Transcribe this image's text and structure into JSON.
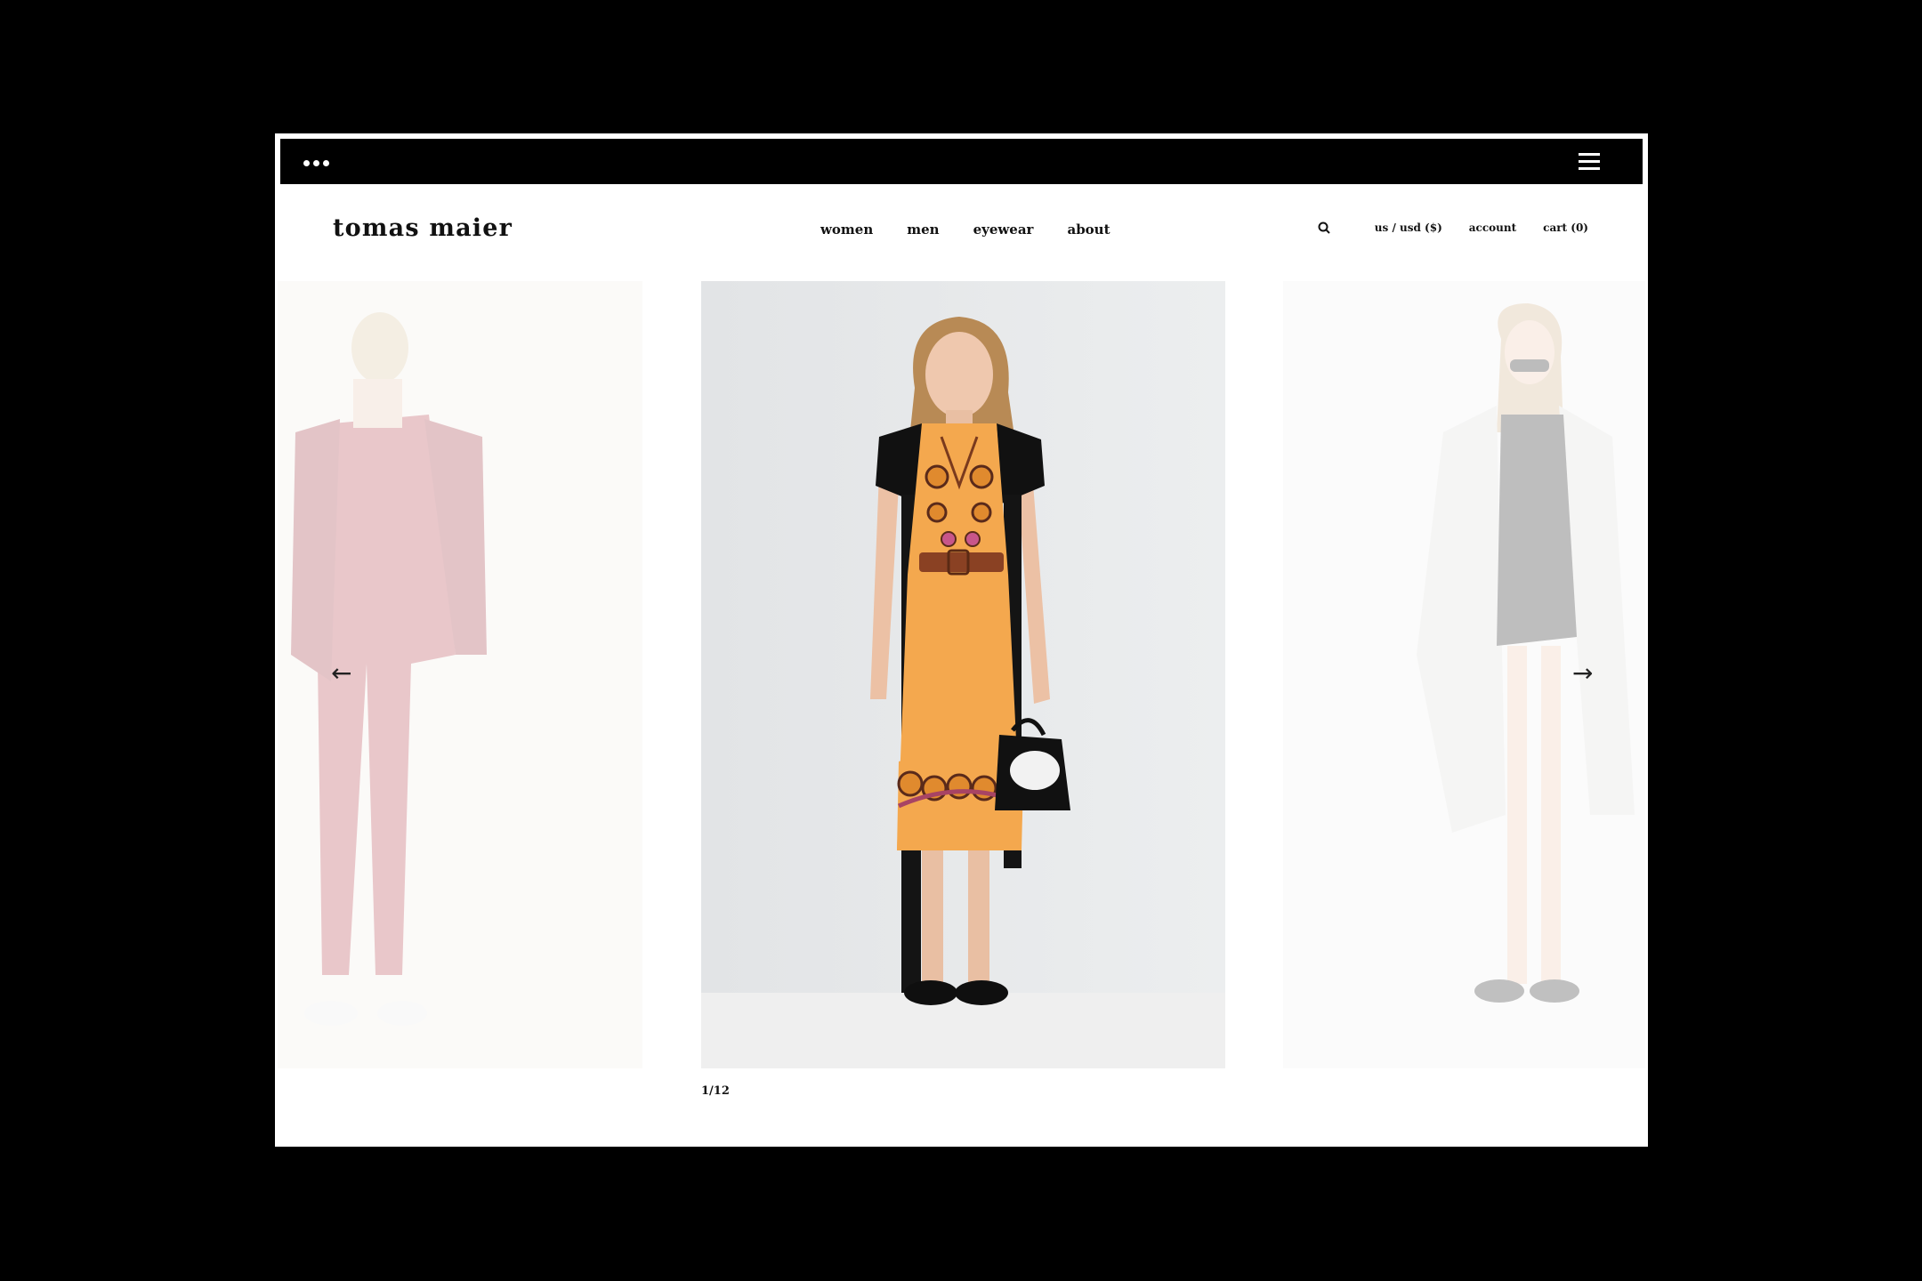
{
  "browser": {
    "menu_dots_icon": "more-dots-icon",
    "hamburger_icon": "hamburger-menu-icon"
  },
  "header": {
    "logo": "tomas maier",
    "nav": [
      "women",
      "men",
      "eyewear",
      "about"
    ],
    "search_icon": "search-icon",
    "locale": "us / usd ($)",
    "account": "account",
    "cart": "cart (0)"
  },
  "carousel": {
    "prev_arrow": "←",
    "next_arrow": "→",
    "counter": "1/12",
    "slides": [
      {
        "name": "look-red-suit",
        "accent": "#b13a45"
      },
      {
        "name": "look-orange-dress",
        "accent": "#f2a24c"
      },
      {
        "name": "look-white-coat",
        "accent": "#e9e7e1"
      }
    ]
  }
}
